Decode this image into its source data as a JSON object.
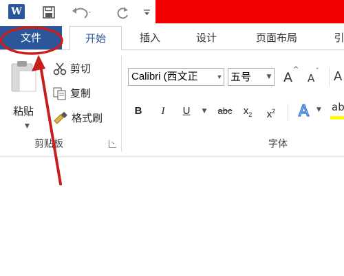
{
  "quick_access": {
    "app_logo": "W",
    "icons": [
      "word-logo-icon",
      "save-icon",
      "undo-icon",
      "redo-icon",
      "customize-icon"
    ]
  },
  "tabs": [
    {
      "key": "file",
      "label": "文件"
    },
    {
      "key": "home",
      "label": "开始"
    },
    {
      "key": "insert",
      "label": "插入"
    },
    {
      "key": "design",
      "label": "设计"
    },
    {
      "key": "layout",
      "label": "页面布局"
    },
    {
      "key": "references",
      "label": "引"
    }
  ],
  "clipboard": {
    "paste_label": "粘贴",
    "cut_label": "剪切",
    "copy_label": "复制",
    "format_painter_label": "格式刷",
    "group_label": "剪贴板"
  },
  "font": {
    "name": "Calibri (西文正",
    "size": "五号",
    "bold": "B",
    "italic": "I",
    "underline": "U",
    "strikethrough": "abc",
    "subscript": "x",
    "superscript": "x",
    "grow": "A",
    "shrink": "A",
    "partial": "A",
    "group_label": "字体"
  },
  "colors": {
    "accent": "#2b579a",
    "redaction": "#f20000",
    "annotation": "#c81e1e"
  }
}
